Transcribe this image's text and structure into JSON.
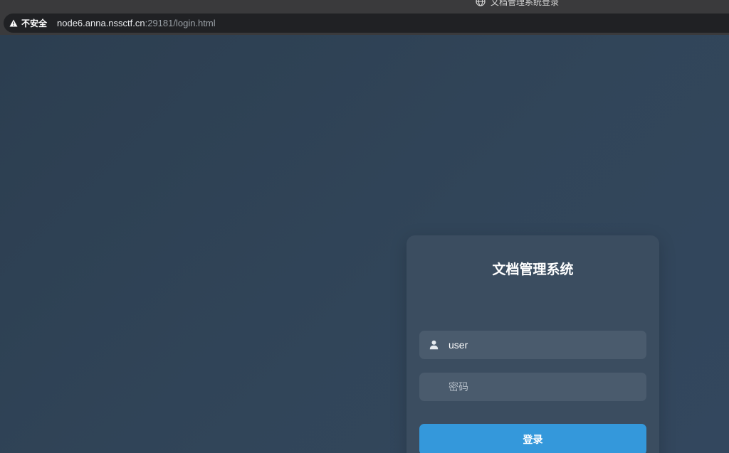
{
  "browser": {
    "tab_title": "文档管理系统登录",
    "tab_icon": "globe-icon",
    "security_label": "不安全",
    "security_icon": "warning-icon",
    "url_host": "node6.anna.nssctf.cn",
    "url_rest": ":29181/login.html"
  },
  "login": {
    "title": "文档管理系统",
    "username": {
      "value": "user",
      "icon": "user-icon"
    },
    "password": {
      "value": "",
      "placeholder": "密码"
    },
    "submit_label": "登录"
  },
  "colors": {
    "background": "#2f4257",
    "card": "#3b4d60",
    "input": "#4a5b6d",
    "accent": "#3498db"
  }
}
